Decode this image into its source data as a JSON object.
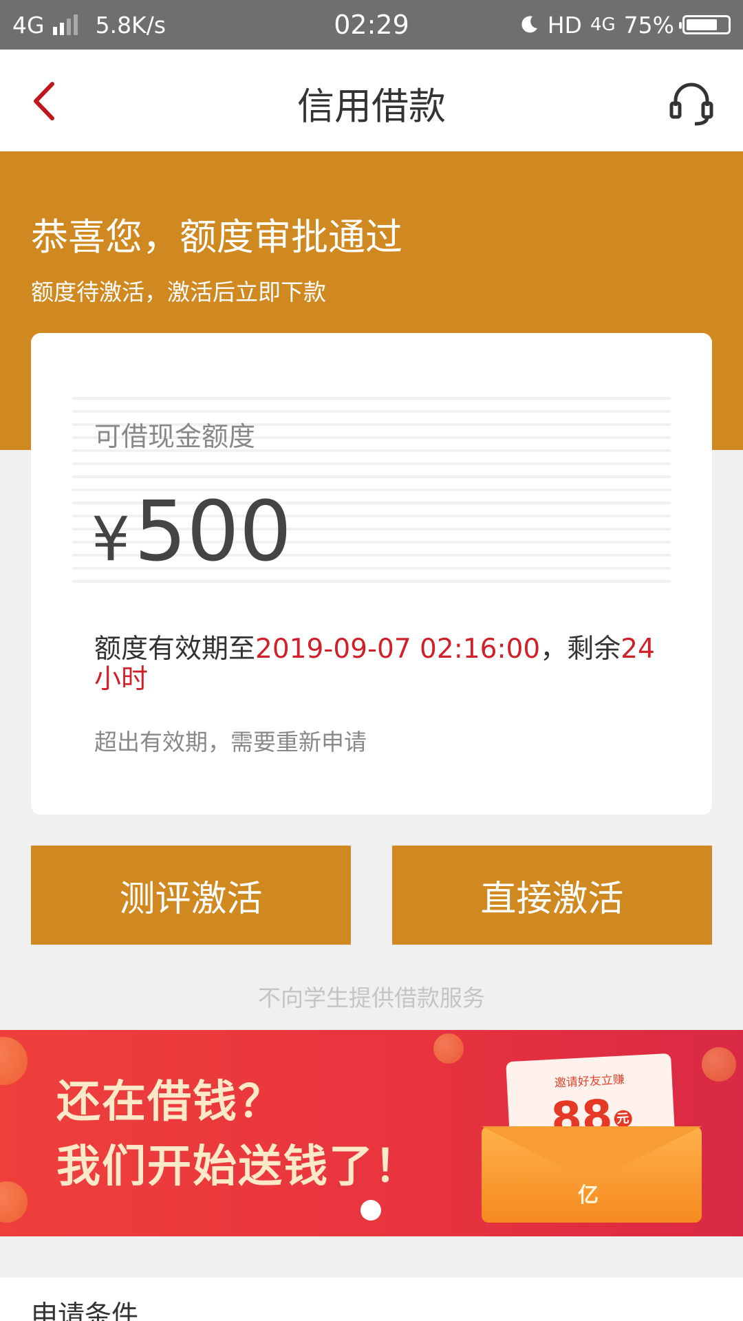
{
  "status_bar": {
    "network": "4G",
    "speed": "5.8K/s",
    "time": "02:29",
    "hd": "HD",
    "net_right": "4G",
    "battery": "75%",
    "battery_level": 0.75
  },
  "nav": {
    "title": "信用借款",
    "back_icon": "chevron-left-icon",
    "support_icon": "headset-icon",
    "back_color": "#c0161d"
  },
  "hero": {
    "title": "恭喜您，额度审批通过",
    "subtitle": "额度待激活，激活后立即下款",
    "color": "#d08920"
  },
  "card": {
    "label": "可借现金额度",
    "currency": "¥",
    "amount": "500",
    "validity_prefix": "额度有效期至",
    "validity_date": "2019-09-07 02:16:00",
    "validity_mid": "，剩余",
    "remaining": "24小时",
    "expire_note": "超出有效期，需要重新申请"
  },
  "buttons": {
    "evaluate": "测评激活",
    "direct": "直接激活"
  },
  "notice": "不向学生提供借款服务",
  "banner": {
    "line1": "还在借钱？",
    "line2": "我们开始送钱了！",
    "envelope_title": "邀请好友立赚",
    "envelope_amount": "88",
    "envelope_unit": "元",
    "envelope_seal": "亿"
  },
  "conditions": {
    "title": "申请条件"
  }
}
